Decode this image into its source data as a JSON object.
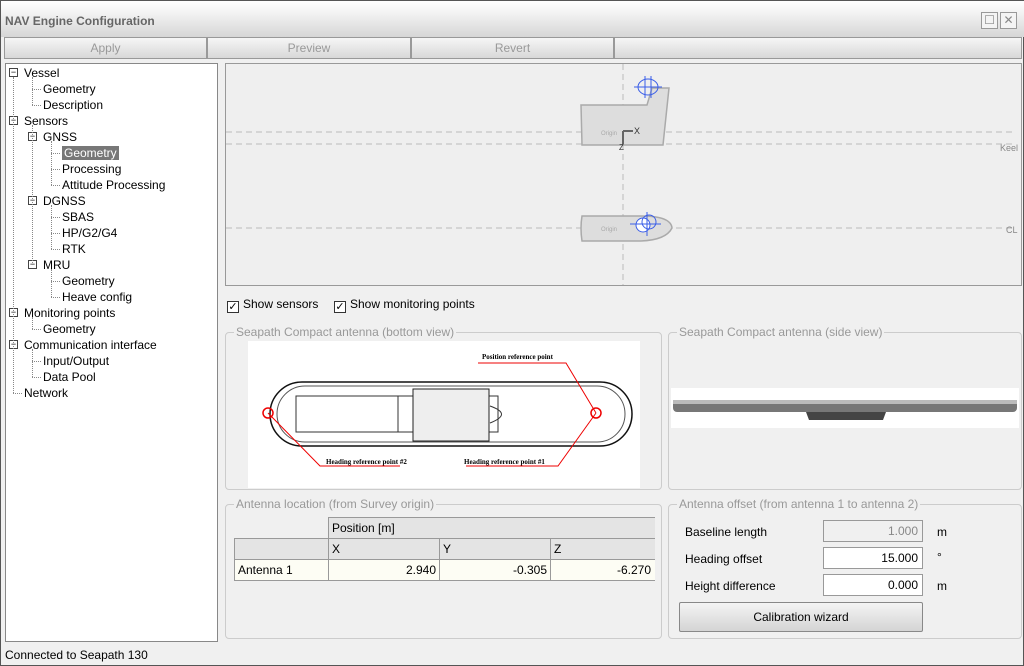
{
  "window": {
    "title": "NAV Engine Configuration",
    "maximize_icon": "maximize-icon",
    "close_icon": "close-icon"
  },
  "toolbar": {
    "apply": "Apply",
    "preview": "Preview",
    "revert": "Revert"
  },
  "tree": [
    {
      "label": "Vessel",
      "level": 0,
      "exp": true
    },
    {
      "label": "Geometry",
      "level": 1
    },
    {
      "label": "Description",
      "level": 1
    },
    {
      "label": "Sensors",
      "level": 0,
      "exp": true
    },
    {
      "label": "GNSS",
      "level": 1,
      "exp": true
    },
    {
      "label": "Geometry",
      "level": 2,
      "selected": true
    },
    {
      "label": "Processing",
      "level": 2
    },
    {
      "label": "Attitude Processing",
      "level": 2
    },
    {
      "label": "DGNSS",
      "level": 1,
      "exp": true
    },
    {
      "label": "SBAS",
      "level": 2
    },
    {
      "label": "HP/G2/G4",
      "level": 2
    },
    {
      "label": "RTK",
      "level": 2
    },
    {
      "label": "MRU",
      "level": 1,
      "exp": true
    },
    {
      "label": "Geometry",
      "level": 2
    },
    {
      "label": "Heave config",
      "level": 2
    },
    {
      "label": "Monitoring points",
      "level": 0,
      "exp": true
    },
    {
      "label": "Geometry",
      "level": 1
    },
    {
      "label": "Communication interface",
      "level": 0,
      "exp": true
    },
    {
      "label": "Input/Output",
      "level": 1
    },
    {
      "label": "Data Pool",
      "level": 1
    },
    {
      "label": "Network",
      "level": 0
    }
  ],
  "canvas": {
    "keel": "Keel",
    "cl": "CL",
    "axis_x": "X",
    "axis_z": "Z",
    "origin": "Origin",
    "sensor_color": "#3a5ee8"
  },
  "options": {
    "show_sensors": "Show sensors",
    "show_sensors_checked": true,
    "show_monitoring": "Show monitoring points",
    "show_monitoring_checked": true
  },
  "bottom_view": {
    "title": "Seapath Compact antenna (bottom view)",
    "position_ref": "Position reference point",
    "heading_ref2": "Heading reference point #2",
    "heading_ref1": "Heading reference point #1"
  },
  "side_view": {
    "title": "Seapath Compact antenna (side view)"
  },
  "location": {
    "title": "Antenna location (from Survey origin)",
    "group_header": "Position [m]",
    "columns": [
      "X",
      "Y",
      "Z"
    ],
    "rows": [
      {
        "name": "Antenna 1",
        "values": [
          "2.940",
          "-0.305",
          "-6.270"
        ]
      }
    ]
  },
  "offset": {
    "title": "Antenna offset (from antenna 1 to antenna 2)",
    "baseline_label": "Baseline length",
    "baseline_value": "1.000",
    "baseline_unit": "m",
    "heading_label": "Heading offset",
    "heading_value": "15.000",
    "heading_unit": "°",
    "height_label": "Height difference",
    "height_value": "0.000",
    "height_unit": "m",
    "wizard": "Calibration wizard"
  },
  "status": {
    "text": "Connected to Seapath 130"
  }
}
